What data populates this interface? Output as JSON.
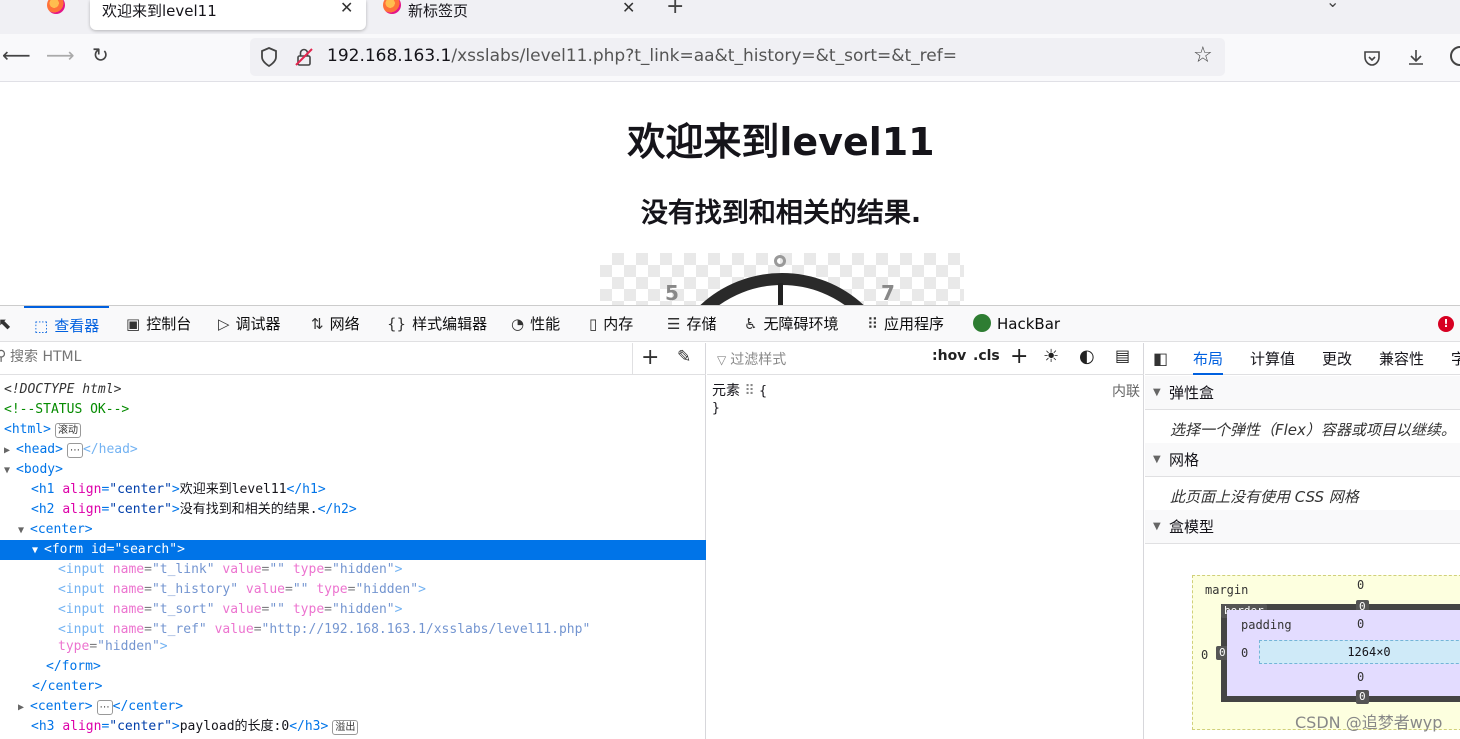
{
  "browser": {
    "tabs": [
      {
        "title": "欢迎来到level11"
      },
      {
        "title": "新标签页"
      }
    ],
    "tab_close_symbol": "✕",
    "new_tab_symbol": "+",
    "url": {
      "host": "192.168.163.1",
      "path": "/xsslabs/level11.php?t_link=aa&t_history=&t_sort=&t_ref="
    }
  },
  "page": {
    "h1": "欢迎来到level11",
    "h2": "没有找到和相关的结果.",
    "clock_numbers": [
      "5",
      "7"
    ]
  },
  "devtools": {
    "tabs": [
      {
        "label": "查看器",
        "icon": "inspector-icon"
      },
      {
        "label": "控制台",
        "icon": "console-icon"
      },
      {
        "label": "调试器",
        "icon": "debugger-icon"
      },
      {
        "label": "网络",
        "icon": "network-icon"
      },
      {
        "label": "样式编辑器",
        "icon": "style-editor-icon"
      },
      {
        "label": "性能",
        "icon": "performance-icon"
      },
      {
        "label": "内存",
        "icon": "memory-icon"
      },
      {
        "label": "存储",
        "icon": "storage-icon"
      },
      {
        "label": "无障碍环境",
        "icon": "accessibility-icon"
      },
      {
        "label": "应用程序",
        "icon": "application-icon"
      },
      {
        "label": "HackBar",
        "icon": "hackbar-icon"
      }
    ],
    "markup": {
      "search_placeholder": "搜索 HTML",
      "lines": {
        "doctype": "<!DOCTYPE html>",
        "comment": "<!--STATUS OK-->",
        "html_badge": "滚动",
        "h1_text": "欢迎来到level11",
        "h2_text": "没有找到和相关的结果.",
        "form_id": "search",
        "t_link": "t_link",
        "t_history": "t_history",
        "t_sort": "t_sort",
        "t_ref": "t_ref",
        "t_ref_value": "http://192.168.163.1/xsslabs/level11.php",
        "hidden": "hidden",
        "h3_text": "payload的长度:0",
        "h3_badge": "溢出"
      }
    },
    "rules": {
      "filter_placeholder": "过滤样式",
      "hov": ":hov",
      "cls": ".cls",
      "element_rule": "元素",
      "inline_label": "内联"
    },
    "layout": {
      "tabs": [
        "布局",
        "计算值",
        "更改",
        "兼容性",
        "字"
      ],
      "flexbox_title": "弹性盒",
      "flexbox_text": "选择一个弹性（Flex）容器或项目以继续。",
      "grid_title": "网格",
      "grid_text": "此页面上没有使用 CSS 网格",
      "boxmodel_title": "盒模型",
      "boxmodel": {
        "margin_label": "margin",
        "border_label": "border",
        "padding_label": "padding",
        "content_size": "1264×0",
        "margin_top": "0",
        "margin_left": "0",
        "border_top": "0",
        "border_left": "0",
        "border_bottom": "0",
        "padding_top": "0",
        "padding_left": "0",
        "padding_bottom": "0"
      }
    }
  },
  "watermark": "CSDN @追梦者wyp"
}
